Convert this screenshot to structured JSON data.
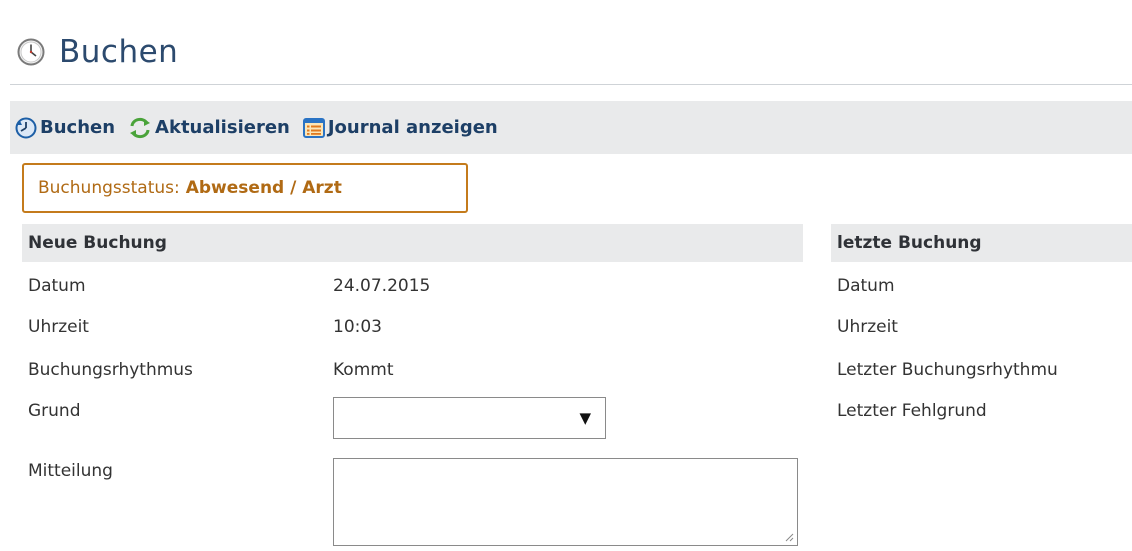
{
  "page": {
    "title": "Buchen"
  },
  "toolbar": {
    "buchen": "Buchen",
    "aktualisieren": "Aktualisieren",
    "journal": "Journal anzeigen"
  },
  "status": {
    "label": "Buchungsstatus:",
    "value": "Abwesend / Arzt"
  },
  "neue": {
    "heading": "Neue Buchung",
    "datum_label": "Datum",
    "datum_value": "24.07.2015",
    "uhrzeit_label": "Uhrzeit",
    "uhrzeit_value": "10:03",
    "rhythmus_label": "Buchungsrhythmus",
    "rhythmus_value": "Kommt",
    "grund_label": "Grund",
    "grund_value": "",
    "mitteilung_label": "Mitteilung",
    "mitteilung_value": ""
  },
  "letzte": {
    "heading": "letzte Buchung",
    "datum_label": "Datum",
    "uhrzeit_label": "Uhrzeit",
    "rhythmus_label": "Letzter Buchungsrhythmu",
    "fehlgrund_label": "Letzter Fehlgrund"
  },
  "colors": {
    "accent": "#c47b1c",
    "link": "#1d3f66",
    "bar": "#e9eaeb"
  },
  "icons": {
    "title": "clock-icon",
    "buchen": "clock-arrow-icon",
    "aktualisieren": "refresh-icon",
    "journal": "journal-list-icon"
  }
}
